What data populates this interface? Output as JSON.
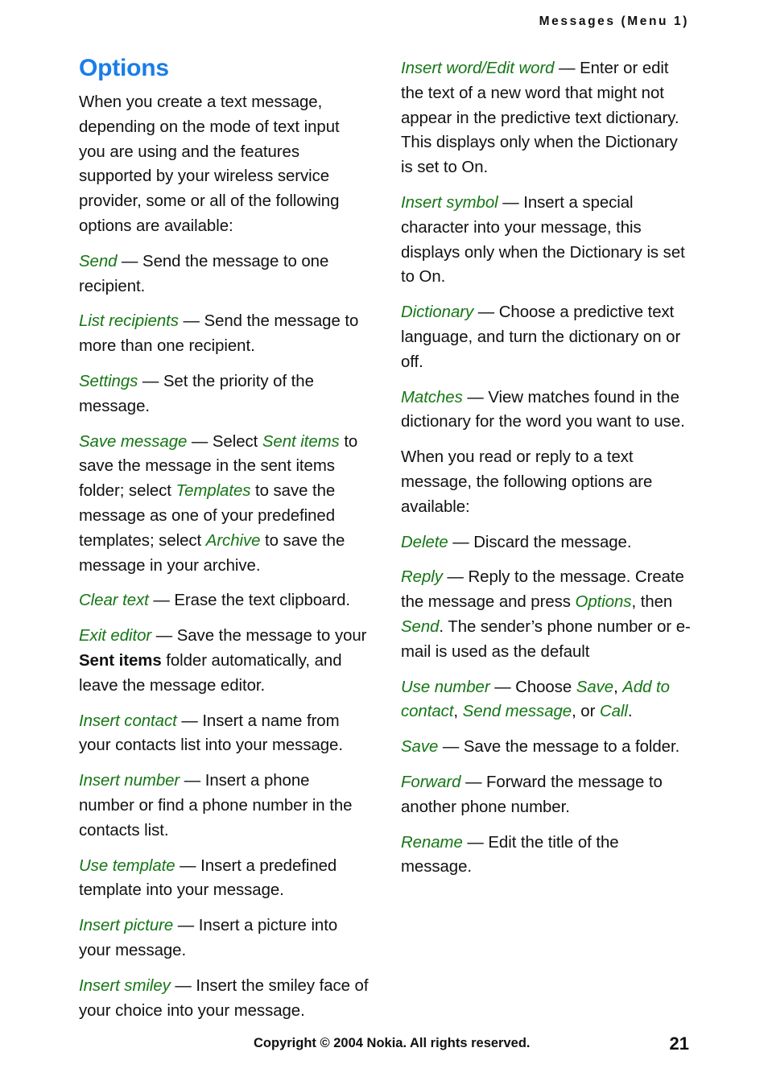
{
  "header": {
    "running_head": "Messages (Menu 1)"
  },
  "colors": {
    "heading_blue": "#1a7de8",
    "term_green": "#147614",
    "body_black": "#111111",
    "page_background": "#ffffff"
  },
  "section": {
    "title": "Options"
  },
  "left_column": {
    "intro": "When you create a text message, depending on the mode of text input you are using and the features supported by your wireless service provider, some or all of the following options are available:",
    "entries": [
      {
        "term": "Send",
        "dash": "—",
        "description": "Send the message to one recipient."
      },
      {
        "term": "List recipients",
        "dash": "—",
        "description": "Send the message to more than one recipient."
      },
      {
        "term": "Settings",
        "dash": "—",
        "description": "Set the priority of the message."
      },
      {
        "term": "Save message",
        "dash": "—",
        "desc_part_1": "Select ",
        "inline_term_1": "Sent items",
        "desc_part_2": " to save the message in the sent items folder; select ",
        "inline_term_2": "Templates",
        "desc_part_3": " to save the message as one of your predefined templates; select ",
        "inline_term_3": "Archive",
        "desc_part_4": " to save the message in your archive."
      },
      {
        "term": "Clear text",
        "dash": "—",
        "description": "Erase the text clipboard."
      },
      {
        "term": "Exit editor",
        "dash": "—",
        "desc_part_1": "Save the message to your ",
        "bold_term": "Sent items",
        "desc_part_2": " folder automatically, and leave the message editor."
      },
      {
        "term": "Insert contact",
        "dash": "—",
        "description": "Insert a name from your contacts list into your message."
      },
      {
        "term": "Insert number",
        "dash": "—",
        "description": "Insert a phone number or find a phone number in the contacts list."
      },
      {
        "term": "Use template",
        "dash": "—",
        "description": "Insert a predefined template into your message."
      },
      {
        "term": "Insert picture",
        "dash": "—",
        "description": "Insert a picture into your message."
      },
      {
        "term": "Insert smiley",
        "dash": "—",
        "description": "Insert the smiley face of your choice into your message."
      }
    ]
  },
  "right_column": {
    "entries": [
      {
        "term": "Insert word/Edit word",
        "dash": "—",
        "description": "Enter or edit the text of a new word that might not appear in the predictive text dictionary. This displays only when the Dictionary is set to On."
      },
      {
        "term": "Insert symbol",
        "dash": "—",
        "description": "Insert a special character into your message, this displays only when the Dictionary is set to On."
      },
      {
        "term": "Dictionary",
        "dash": "—",
        "description": "Choose a predictive text language, and turn the dictionary on or off."
      },
      {
        "term": "Matches",
        "dash": "—",
        "description": "View matches found in the dictionary for the word you want to use."
      }
    ],
    "mid_intro": "When you read or reply to a text message, the following options are available:",
    "entries_2": [
      {
        "term": "Delete",
        "dash": "—",
        "description": "Discard the message."
      },
      {
        "term": "Reply",
        "dash": "—",
        "desc_part_1": "Reply to the message. Create the message and press ",
        "inline_term_1": "Options",
        "desc_part_2": ", then ",
        "inline_term_2": "Send",
        "desc_part_3": ". The sender’s phone number or e-mail is used as the default"
      },
      {
        "term": "Use number",
        "dash": "—",
        "desc_part_1": "Choose ",
        "inline_term_1": "Save",
        "desc_part_2": ", ",
        "inline_term_2": "Add to contact",
        "desc_part_3": ", ",
        "inline_term_3": "Send message",
        "desc_part_4": ", or ",
        "inline_term_4": "Call",
        "desc_part_5": "."
      },
      {
        "term": "Save",
        "dash": "—",
        "description": "Save the message to a folder."
      },
      {
        "term": "Forward",
        "dash": "—",
        "description": "Forward the message to another phone number."
      },
      {
        "term": "Rename",
        "dash": "—",
        "description": "Edit the title of the message."
      }
    ]
  },
  "footer": {
    "copyright": "Copyright © 2004 Nokia. All rights reserved.",
    "page_number": "21"
  }
}
